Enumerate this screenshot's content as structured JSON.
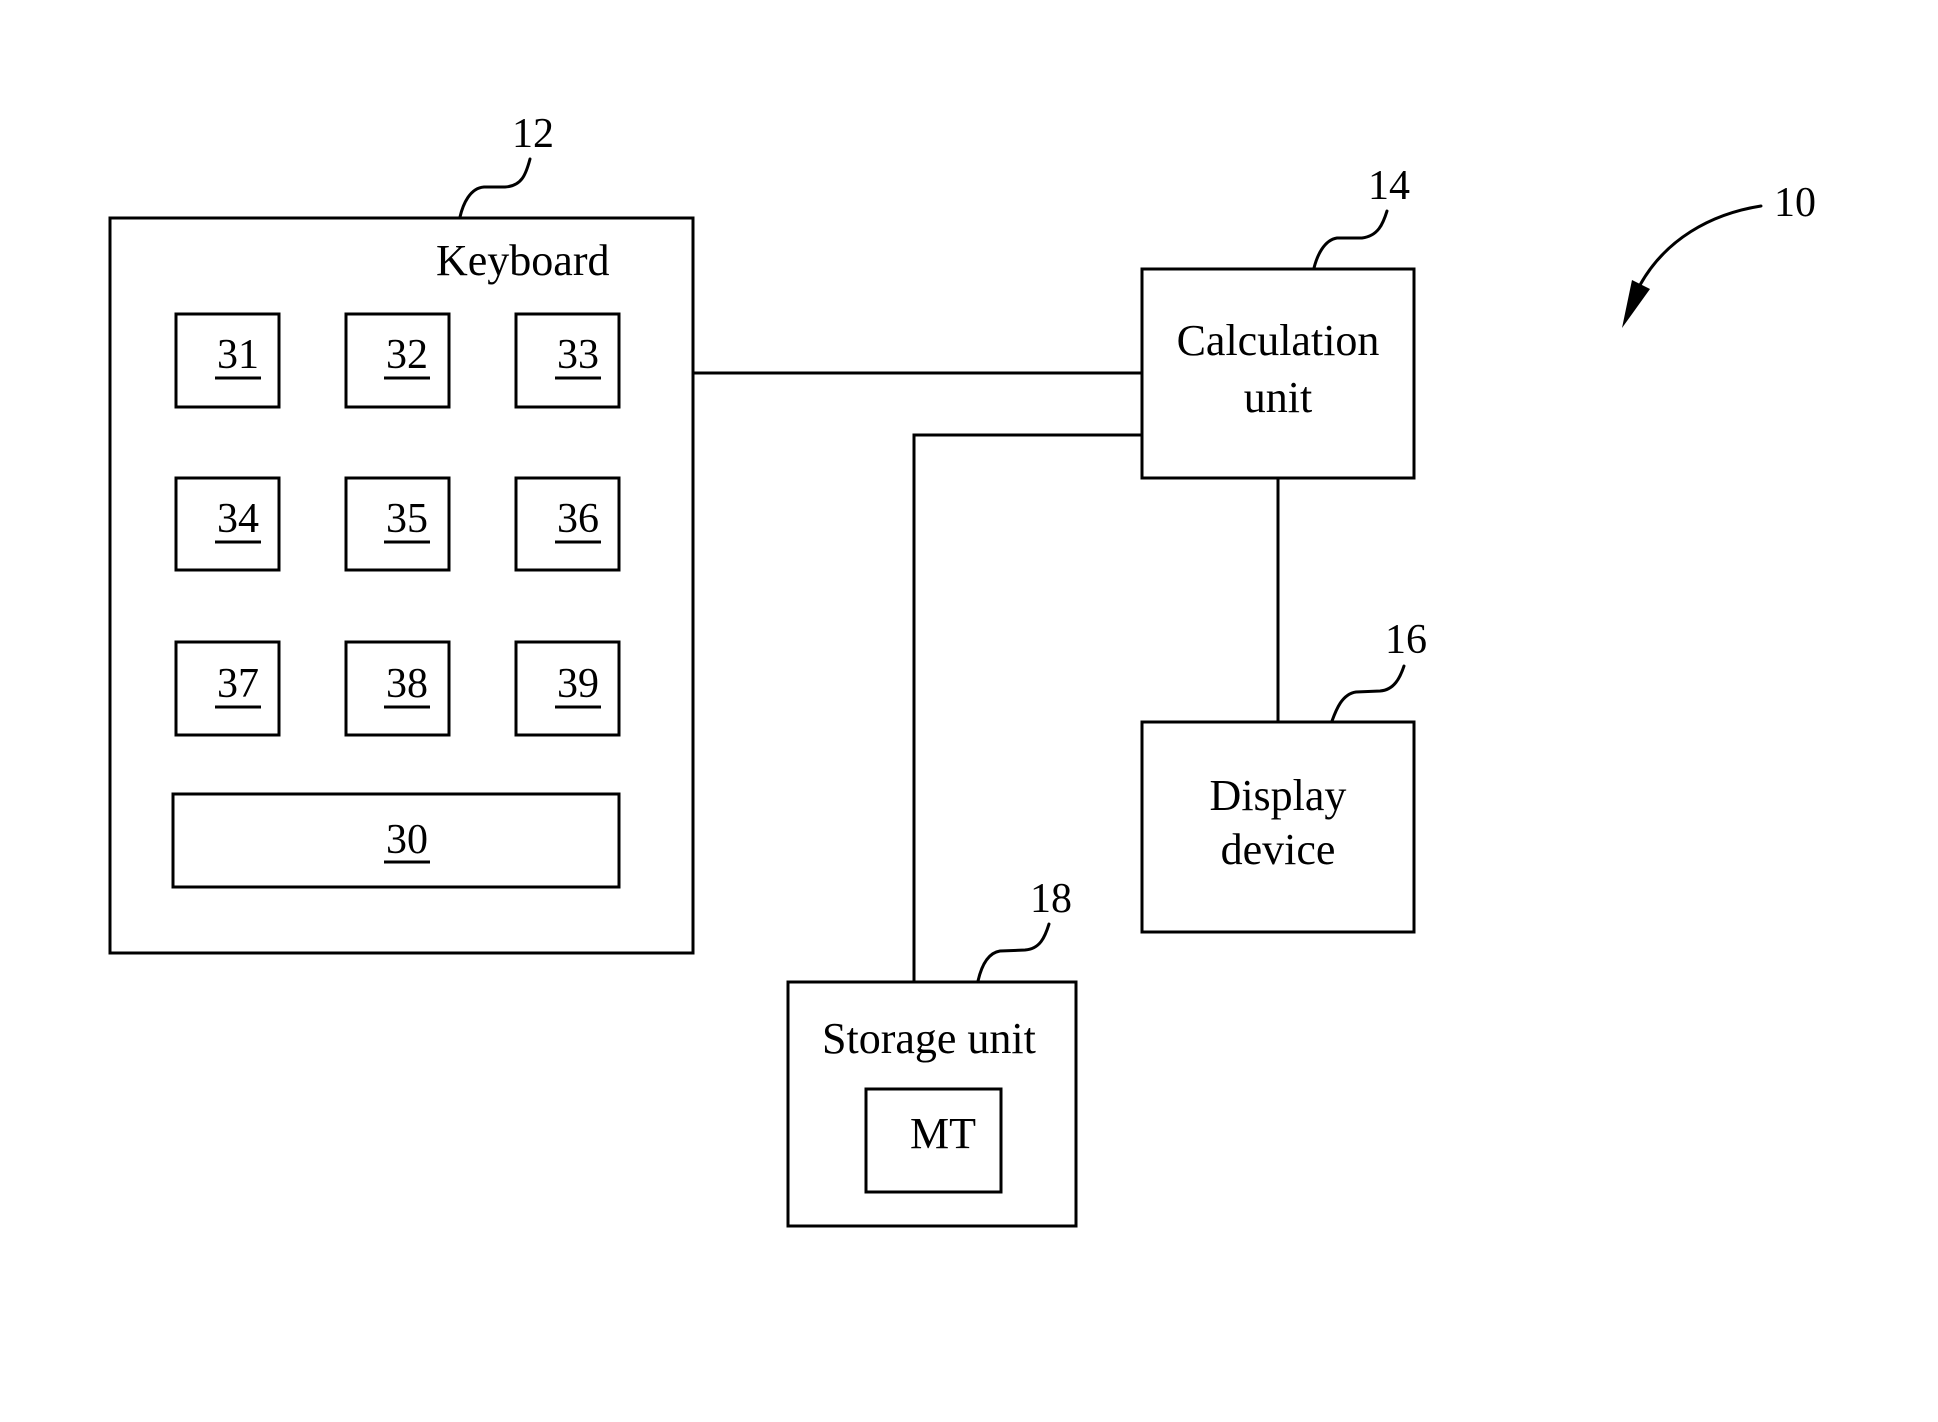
{
  "figure": {
    "ref": "10"
  },
  "keyboard": {
    "ref": "12",
    "label": "Keyboard",
    "keys": [
      "31",
      "32",
      "33",
      "34",
      "35",
      "36",
      "37",
      "38",
      "39"
    ],
    "bar": "30"
  },
  "calculation_unit": {
    "ref": "14",
    "line1": "Calculation",
    "line2": "unit"
  },
  "display_device": {
    "ref": "16",
    "line1": "Display",
    "line2": "device"
  },
  "storage_unit": {
    "ref": "18",
    "label": "Storage unit",
    "inner": "MT"
  },
  "connections": [
    {
      "from": "Keyboard",
      "to": "Calculation unit"
    },
    {
      "from": "Storage unit",
      "to": "Calculation unit"
    },
    {
      "from": "Calculation unit",
      "to": "Display device"
    }
  ]
}
